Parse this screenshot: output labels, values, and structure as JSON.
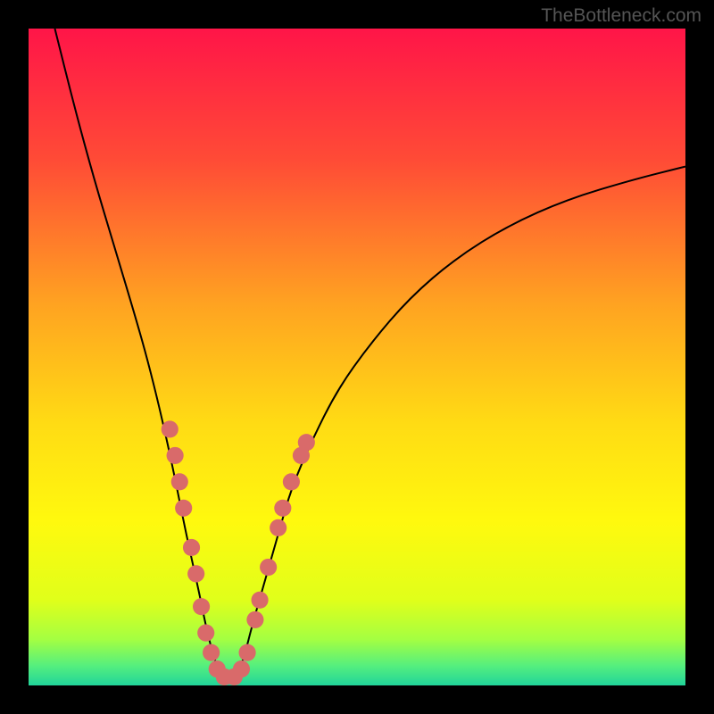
{
  "watermark": "TheBottleneck.com",
  "chart_data": {
    "type": "line",
    "title": "",
    "xlabel": "",
    "ylabel": "",
    "xlim": [
      0,
      100
    ],
    "ylim": [
      0,
      100
    ],
    "gradient_stops": [
      {
        "offset": 0,
        "color": "#ff1548"
      },
      {
        "offset": 0.2,
        "color": "#ff4b36"
      },
      {
        "offset": 0.42,
        "color": "#ffa321"
      },
      {
        "offset": 0.6,
        "color": "#ffdb14"
      },
      {
        "offset": 0.75,
        "color": "#fff90e"
      },
      {
        "offset": 0.87,
        "color": "#e0ff1a"
      },
      {
        "offset": 0.93,
        "color": "#a4ff42"
      },
      {
        "offset": 0.97,
        "color": "#55ef7e"
      },
      {
        "offset": 1.0,
        "color": "#21d49a"
      }
    ],
    "series": [
      {
        "name": "bottleneck-curve",
        "x": [
          4,
          7,
          10,
          13,
          16,
          18,
          20,
          22,
          24,
          26,
          27,
          28,
          29,
          30,
          31,
          32,
          33,
          34,
          36,
          38,
          40,
          43,
          47,
          52,
          58,
          65,
          73,
          82,
          92,
          100
        ],
        "y": [
          100,
          88,
          77,
          67,
          57,
          50,
          42,
          33,
          23,
          14,
          9,
          5,
          2,
          1,
          1,
          2,
          5,
          9,
          16,
          23,
          30,
          37,
          45,
          52,
          59,
          65,
          70,
          74,
          77,
          79
        ]
      }
    ],
    "markers": [
      {
        "x": 21.5,
        "y": 39
      },
      {
        "x": 22.3,
        "y": 35
      },
      {
        "x": 23.0,
        "y": 31
      },
      {
        "x": 23.6,
        "y": 27
      },
      {
        "x": 24.8,
        "y": 21
      },
      {
        "x": 25.5,
        "y": 17
      },
      {
        "x": 26.3,
        "y": 12
      },
      {
        "x": 27.0,
        "y": 8
      },
      {
        "x": 27.8,
        "y": 5
      },
      {
        "x": 28.7,
        "y": 2.5
      },
      {
        "x": 29.8,
        "y": 1.3
      },
      {
        "x": 31.3,
        "y": 1.3
      },
      {
        "x": 32.4,
        "y": 2.5
      },
      {
        "x": 33.3,
        "y": 5
      },
      {
        "x": 34.5,
        "y": 10
      },
      {
        "x": 35.2,
        "y": 13
      },
      {
        "x": 36.5,
        "y": 18
      },
      {
        "x": 38.0,
        "y": 24
      },
      {
        "x": 38.7,
        "y": 27
      },
      {
        "x": 40.0,
        "y": 31
      },
      {
        "x": 41.5,
        "y": 35
      },
      {
        "x": 42.3,
        "y": 37
      }
    ],
    "marker_color": "#d96a6a",
    "curve_color": "#000000"
  }
}
